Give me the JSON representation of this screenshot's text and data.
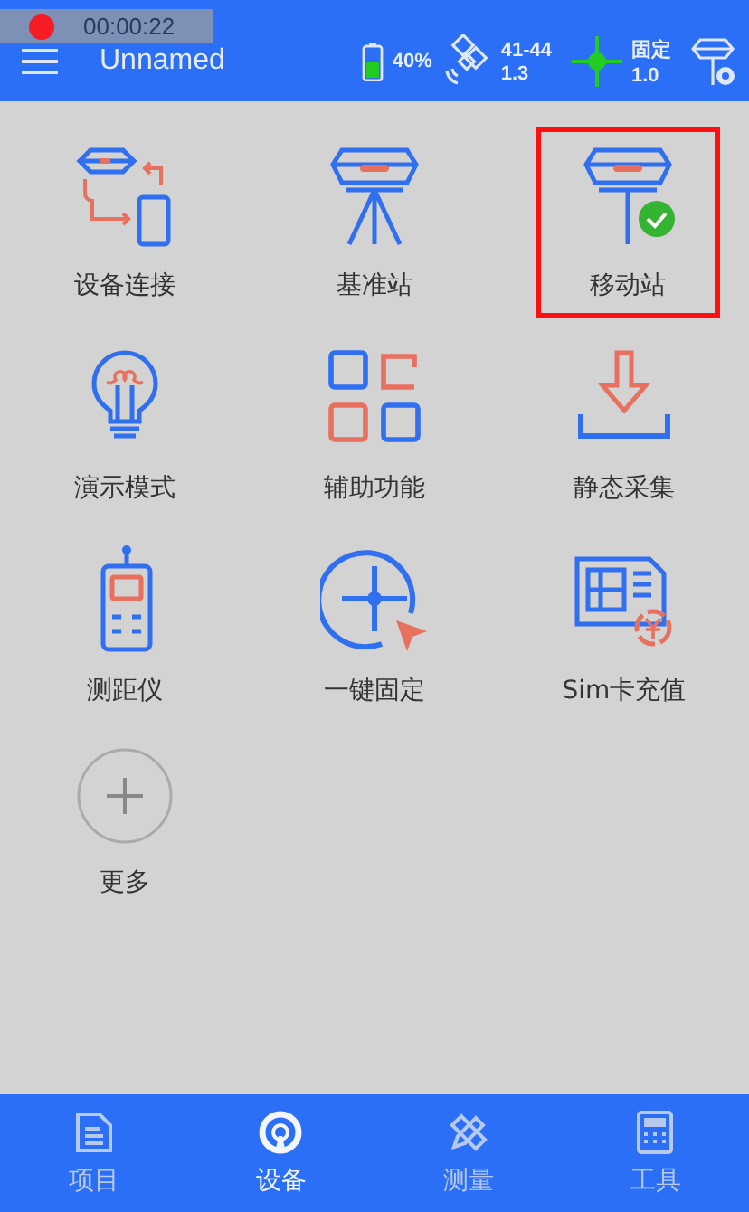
{
  "recording": {
    "time": "00:00:22"
  },
  "header": {
    "title": "Unnamed",
    "battery": "40%",
    "satellites": "41-44",
    "pdop": "1.3",
    "solution": "固定",
    "age": "1.0"
  },
  "tiles": [
    {
      "label": "设备连接",
      "selected": false
    },
    {
      "label": "基准站",
      "selected": false
    },
    {
      "label": "移动站",
      "selected": true
    },
    {
      "label": "演示模式",
      "selected": false
    },
    {
      "label": "辅助功能",
      "selected": false
    },
    {
      "label": "静态采集",
      "selected": false
    },
    {
      "label": "测距仪",
      "selected": false
    },
    {
      "label": "一键固定",
      "selected": false
    },
    {
      "label": "Sim卡充值",
      "selected": false
    },
    {
      "label": "更多",
      "selected": false
    }
  ],
  "bottom_nav": [
    {
      "label": "项目",
      "selected": false
    },
    {
      "label": "设备",
      "selected": true
    },
    {
      "label": "测量",
      "selected": false
    },
    {
      "label": "工具",
      "selected": false
    }
  ]
}
